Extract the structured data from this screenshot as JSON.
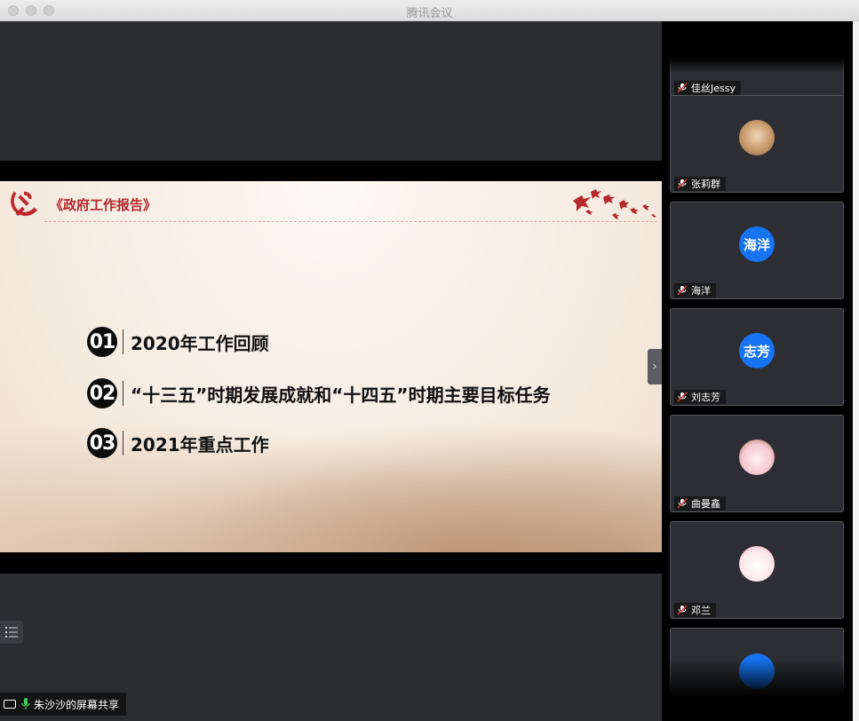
{
  "window": {
    "title": "腾讯会议"
  },
  "slide": {
    "header": "《政府工作报告》",
    "agenda": [
      {
        "num": "01",
        "text": "2020年工作回顾"
      },
      {
        "num": "02",
        "text": "“十三五”时期发展成就和“十四五”时期主要目标任务"
      },
      {
        "num": "03",
        "text": "2021年重点工作"
      }
    ]
  },
  "share_status": {
    "label": "朱沙沙的屏幕共享"
  },
  "participants": [
    {
      "name": "佳丝Jessy",
      "avatar_text": ""
    },
    {
      "name": "张莉群",
      "avatar_text": ""
    },
    {
      "name": "海洋",
      "avatar_text": "海洋"
    },
    {
      "name": "刘志芳",
      "avatar_text": "志芳"
    },
    {
      "name": "曲曼鑫",
      "avatar_text": ""
    },
    {
      "name": "邓兰",
      "avatar_text": ""
    }
  ],
  "icons": {
    "muted_mic": "muted-mic-icon",
    "mic": "mic-icon",
    "screen_share": "monitor-icon",
    "list": "list-icon",
    "next": "chevron-right-icon"
  },
  "colors": {
    "accent_red": "#b3272b",
    "avatar_blue": "#1673f1"
  }
}
